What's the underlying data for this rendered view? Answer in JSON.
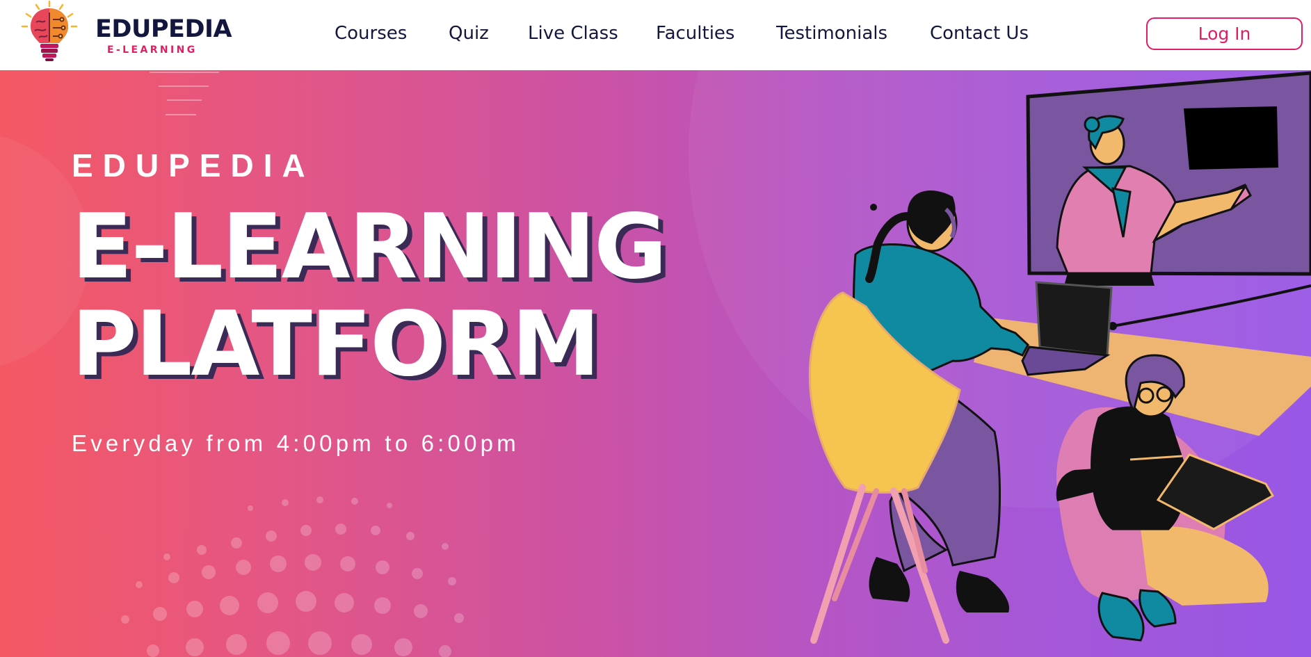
{
  "brand": {
    "name": "EDUPEDIA",
    "tagline": "E-LEARNING",
    "colors": {
      "navy": "#14173d",
      "pink": "#e11d63"
    }
  },
  "nav": {
    "items": [
      {
        "label": "Courses"
      },
      {
        "label": "Quiz"
      },
      {
        "label": "Live Class"
      },
      {
        "label": "Faculties"
      },
      {
        "label": "Testimonials"
      },
      {
        "label": "Contact Us"
      }
    ],
    "login_label": "Log In"
  },
  "hero": {
    "eyebrow": "EDUPEDIA",
    "title_line1": "E-LEARNING",
    "title_line2": "PLATFORM",
    "tagline": "Everyday from 4:00pm to 6:00pm",
    "illustration": "online-class-illustration",
    "gradient": [
      "#f45863",
      "#cc52a4",
      "#9857e6"
    ]
  }
}
